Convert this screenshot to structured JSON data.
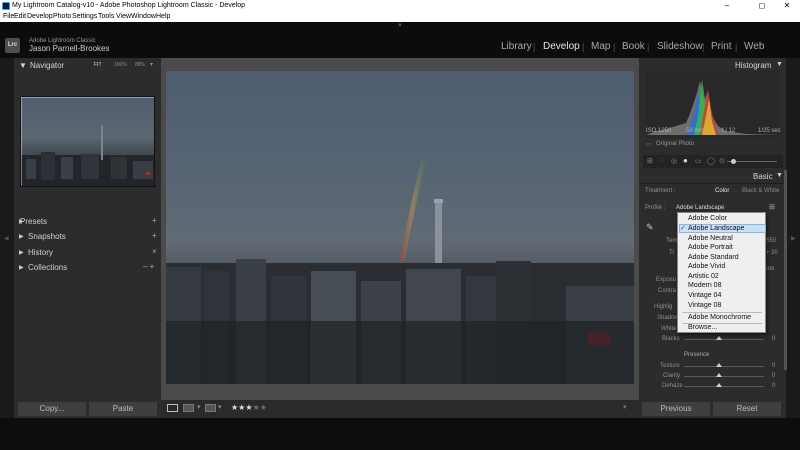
{
  "window": {
    "title": "My Lightroom Catalog-v10 - Adobe Photoshop Lightroom Classic - Develop",
    "minimize": "–",
    "maximize": "◻",
    "close": "✕"
  },
  "menu": [
    "File",
    "Edit",
    "Develop",
    "Photo",
    "Settings",
    "Tools",
    "View",
    "Window",
    "Help"
  ],
  "identity": {
    "badge": "Lrc",
    "product": "Adobe Lightroom Classic",
    "user": "Jason Parnell-Brookes"
  },
  "modules": [
    "Library",
    "Develop",
    "Map",
    "Book",
    "Slideshow",
    "Print",
    "Web"
  ],
  "active_module": "Develop",
  "left_panel": {
    "navigator": {
      "title": "Navigator",
      "zoom": [
        "FIT",
        "100%",
        "88%"
      ]
    },
    "sections": [
      {
        "title": "Presets",
        "action": "+"
      },
      {
        "title": "Snapshots",
        "action": "+"
      },
      {
        "title": "History",
        "action": "×"
      },
      {
        "title": "Collections",
        "action": "– +"
      }
    ],
    "copy_button": "Copy...",
    "paste_button": "Paste"
  },
  "right_panel": {
    "histogram": {
      "title": "Histogram",
      "iso": "ISO 1250",
      "focal": "50 mm",
      "aperture": "f / 12",
      "shutter": "1/25 sec",
      "original_photo": "Original Photo"
    },
    "basic": {
      "title": "Basic",
      "treatment_label": "Treatment :",
      "treatment_color": "Color",
      "treatment_bw": "Black & White",
      "profile_label": "Profile :",
      "profile_value": "Adobe Landscape",
      "partial_labels": [
        "Tem",
        "Ti",
        "Exposu",
        "Contra",
        "Highlig",
        "Shadow",
        "White",
        "Blacks"
      ],
      "partial_values": [
        "550",
        "+ 30",
        "uto"
      ],
      "presence_title": "Presence",
      "presence": [
        {
          "label": "Texture",
          "value": "0"
        },
        {
          "label": "Clarity",
          "value": "0"
        },
        {
          "label": "Dehaze",
          "value": "0"
        }
      ],
      "blacks_value": "0"
    },
    "previous_button": "Previous",
    "reset_button": "Reset"
  },
  "profile_dropdown": {
    "selected": "Adobe Landscape",
    "items": [
      "Adobe Color",
      "Adobe Landscape",
      "Adobe Neutral",
      "Adobe Portrait",
      "Adobe Standard",
      "Adobe Vivid",
      "Artistic 02",
      "Modern 08",
      "Vintage 04",
      "Vintage 08",
      "Adobe Monochrome",
      "Browse..."
    ],
    "checkmark": "✓"
  },
  "toolbar": {
    "rating": "★★★",
    "rating_empty": "★★"
  },
  "colors": {
    "panel_bg": "#2c2c2c",
    "center_bg": "#4b4b4b",
    "identity_bg": "#0c0c0c",
    "dropdown_bg": "#efefef",
    "selection_bg": "#c7dff7"
  }
}
